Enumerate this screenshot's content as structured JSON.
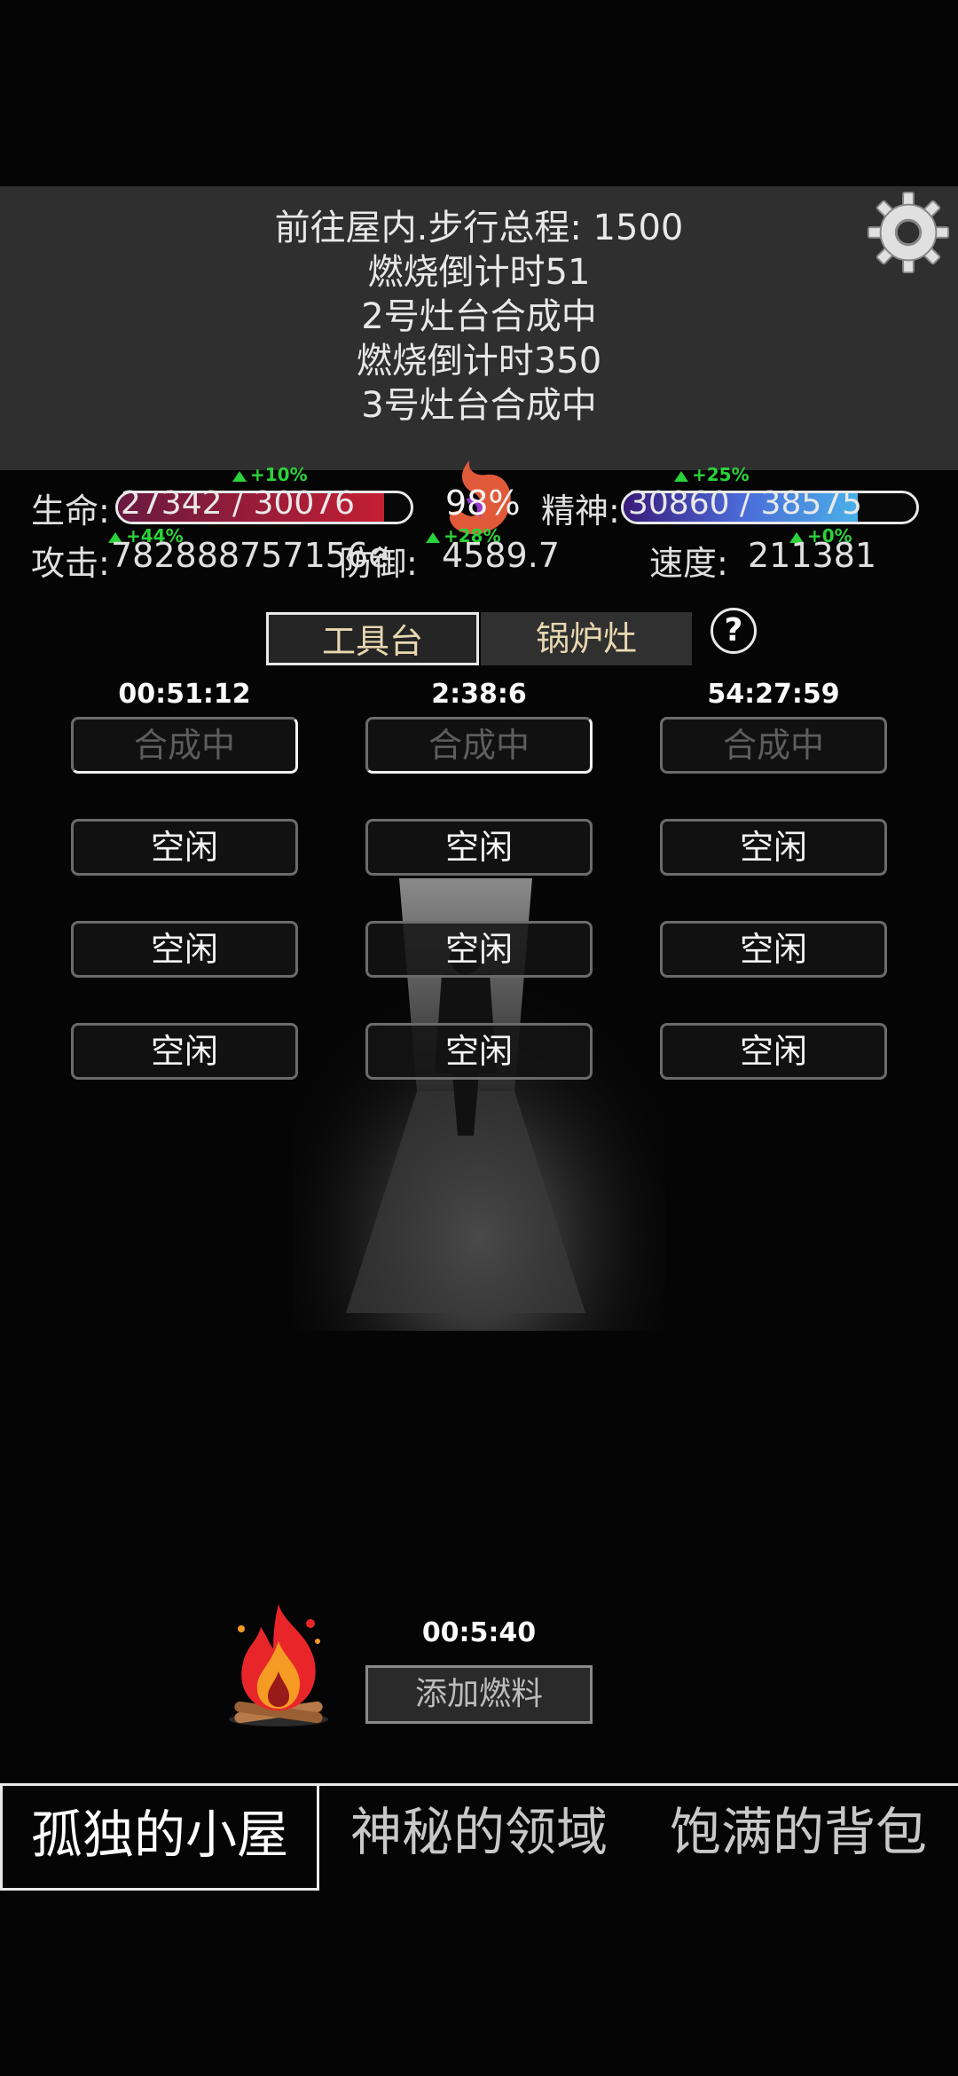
{
  "log_lines": [
    "前往屋内.步行总程: 1500",
    "燃烧倒计时51",
    "2号灶台合成中",
    "燃烧倒计时350",
    "3号灶台合成中"
  ],
  "stats": {
    "life_label": "生命:",
    "life_value": "27342 / 30076",
    "life_fraction": 0.909,
    "life_boost": "+10%",
    "hunger_percent": "98%",
    "spirit_label": "精神:",
    "spirit_value": "30860 / 38575",
    "spirit_fraction": 0.8,
    "spirit_boost": "+25%",
    "attack_label": "攻击:",
    "attack_value": "782888757156e",
    "attack_boost": "+44%",
    "defense_label": "防御:",
    "defense_value": "4589.7",
    "defense_boost": "+28%",
    "speed_label": "速度:",
    "speed_value": "211381",
    "speed_boost": "+0%"
  },
  "tabs": {
    "workbench": "工具台",
    "boiler": "锅炉灶"
  },
  "help_label": "?",
  "timers": [
    "00:51:12",
    "2:38:6",
    "54:27:59"
  ],
  "slots": [
    [
      "合成中",
      "合成中",
      "合成中"
    ],
    [
      "空闲",
      "空闲",
      "空闲"
    ],
    [
      "空闲",
      "空闲",
      "空闲"
    ],
    [
      "空闲",
      "空闲",
      "空闲"
    ]
  ],
  "fire": {
    "timer": "00:5:40",
    "add_fuel": "添加燃料"
  },
  "bottom_nav": [
    "孤独的小屋",
    "神秘的领域",
    "饱满的背包"
  ],
  "colors": {
    "life_bar": "#c41f33",
    "spirit_bar": "#4a3aa0",
    "boost_green": "#2bd23a"
  }
}
